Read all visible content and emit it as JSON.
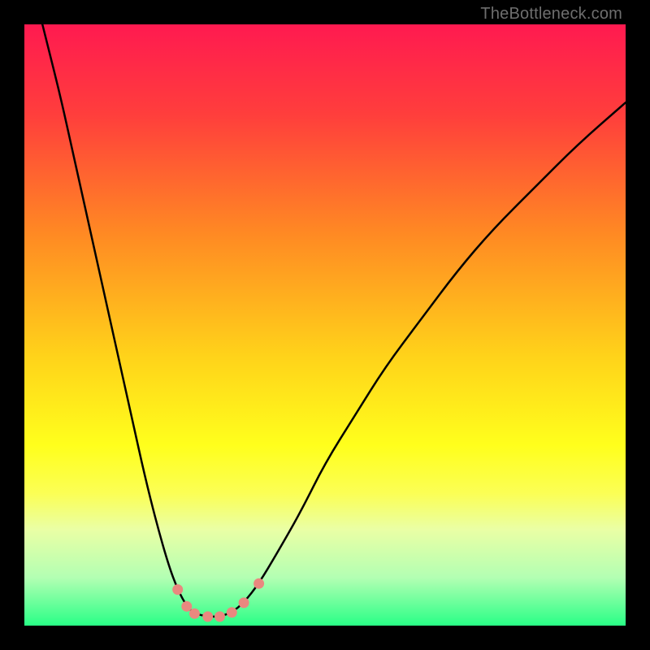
{
  "watermark": "TheBottleneck.com",
  "chart_data": {
    "type": "line",
    "title": "",
    "xlabel": "",
    "ylabel": "",
    "xlim": [
      0,
      100
    ],
    "ylim": [
      0,
      100
    ],
    "background_gradient": {
      "stops": [
        {
          "offset": 0,
          "color": "#ff1a50"
        },
        {
          "offset": 15,
          "color": "#ff3e3c"
        },
        {
          "offset": 35,
          "color": "#ff8a23"
        },
        {
          "offset": 55,
          "color": "#ffd21a"
        },
        {
          "offset": 70,
          "color": "#ffff1c"
        },
        {
          "offset": 78,
          "color": "#fbff55"
        },
        {
          "offset": 84,
          "color": "#eaffa5"
        },
        {
          "offset": 92,
          "color": "#b3ffb3"
        },
        {
          "offset": 100,
          "color": "#29ff86"
        }
      ]
    },
    "series": [
      {
        "name": "bottleneck-curve",
        "color": "#000000",
        "x": [
          0,
          2,
          4,
          6,
          8,
          10,
          12,
          14,
          16,
          18,
          20,
          22,
          24,
          25.5,
          27,
          28.3,
          30.5,
          32.5,
          34.5,
          36.5,
          39,
          42,
          46,
          50,
          55,
          60,
          66,
          72,
          78,
          85,
          92,
          100
        ],
        "values": [
          112,
          104,
          96,
          88,
          79,
          70,
          61,
          52,
          43,
          34,
          25,
          17,
          10,
          6,
          3.2,
          2.0,
          1.5,
          1.5,
          2.2,
          3.8,
          7,
          12,
          19,
          27,
          35,
          43,
          51,
          59,
          66,
          73,
          80,
          87
        ]
      }
    ],
    "markers": {
      "name": "trough-points",
      "color": "#e9887f",
      "radius": 6.5,
      "points": [
        {
          "x": 25.5,
          "y": 6.0
        },
        {
          "x": 27.0,
          "y": 3.2
        },
        {
          "x": 28.3,
          "y": 2.0
        },
        {
          "x": 30.5,
          "y": 1.5
        },
        {
          "x": 32.5,
          "y": 1.5
        },
        {
          "x": 34.5,
          "y": 2.2
        },
        {
          "x": 36.5,
          "y": 3.8
        },
        {
          "x": 39.0,
          "y": 7.0
        }
      ]
    }
  }
}
